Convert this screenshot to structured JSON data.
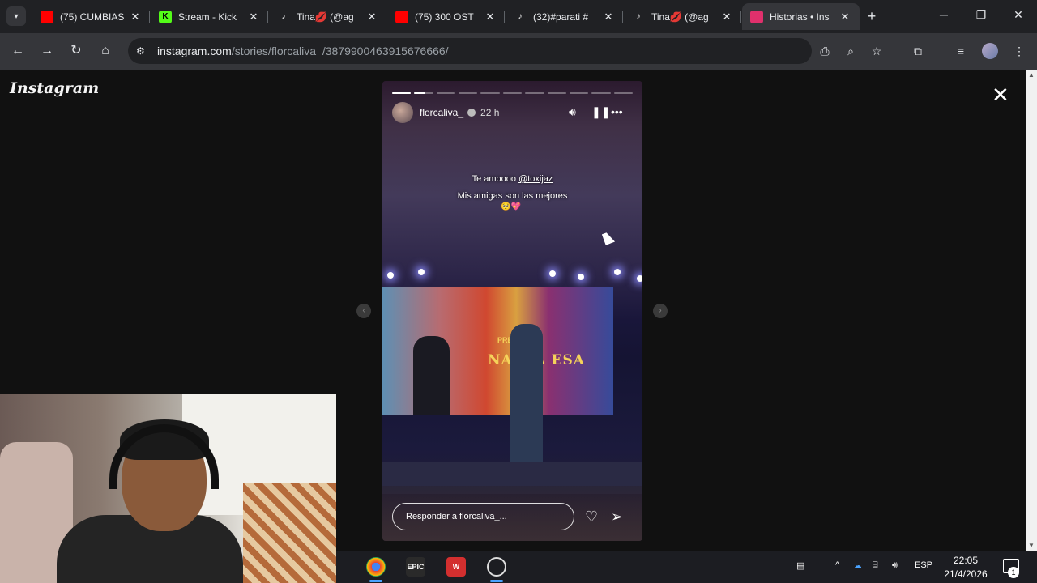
{
  "browser": {
    "tabs": [
      {
        "title": "(75) CUMBIAS",
        "icon": "youtube-icon",
        "color": "#ff0000"
      },
      {
        "title": "Stream - Kick",
        "icon": "kick-icon",
        "color": "#53fc18"
      },
      {
        "title": "Tina💋 (@ag",
        "icon": "tiktok-icon",
        "color": "#ffffff"
      },
      {
        "title": "(75) 300 OST",
        "icon": "youtube-icon",
        "color": "#ff0000"
      },
      {
        "title": "(32)#parati #",
        "icon": "tiktok-icon",
        "color": "#ffffff"
      },
      {
        "title": "Tina💋 (@ag",
        "icon": "tiktok-icon",
        "color": "#ffffff"
      },
      {
        "title": "Historias • Ins",
        "icon": "instagram-icon",
        "color": "#e1306c",
        "active": true
      }
    ],
    "url_host": "instagram.com",
    "url_path": "/stories/florcaliva_/3879900463915676666/"
  },
  "page": {
    "logo": "Instagram",
    "story": {
      "username": "florcaliva_",
      "time": "22 h",
      "caption_prefix": "Te amoooo ",
      "caption_mention": "@toxijaz",
      "caption_line2": "Mis amigas son las mejores",
      "caption_emoji": "🥺💖",
      "screen_text": "NA MA ESA",
      "screen_text_small": "PREMIOS",
      "reply_placeholder": "Responder a florcaliva_...",
      "segments": [
        1,
        0.6,
        0,
        0,
        0,
        0,
        0,
        0,
        0,
        0,
        0
      ]
    }
  },
  "taskbar": {
    "lang": "ESP",
    "time": "22:05",
    "date": "21/4/2026",
    "notifications": "1"
  }
}
